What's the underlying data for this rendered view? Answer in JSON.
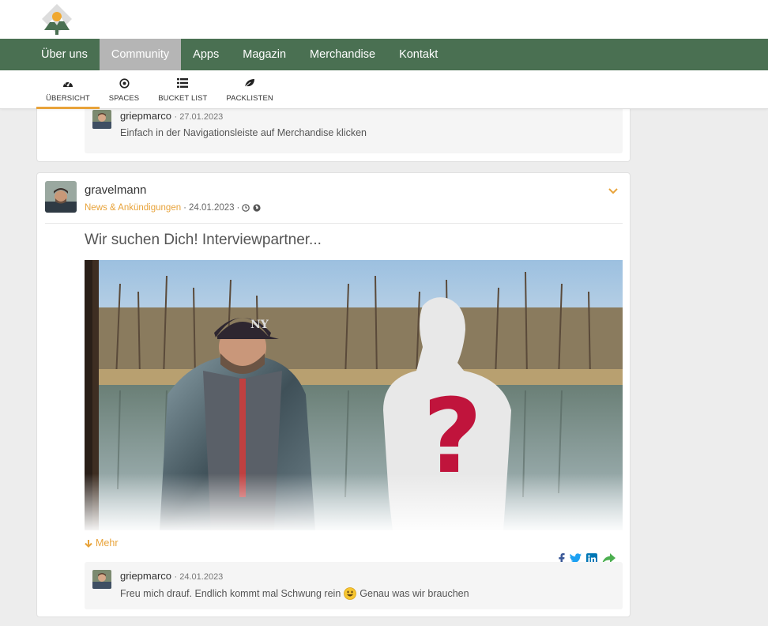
{
  "nav": {
    "items": [
      {
        "label": "Über uns",
        "active": false
      },
      {
        "label": "Community",
        "active": true
      },
      {
        "label": "Apps",
        "active": false
      },
      {
        "label": "Magazin",
        "active": false
      },
      {
        "label": "Merchandise",
        "active": false
      },
      {
        "label": "Kontakt",
        "active": false
      }
    ]
  },
  "subnav": {
    "items": [
      {
        "label": "ÜBERSICHT",
        "icon": "dashboard-icon",
        "active": true
      },
      {
        "label": "SPACES",
        "icon": "target-icon",
        "active": false
      },
      {
        "label": "BUCKET LIST",
        "icon": "list-icon",
        "active": false
      },
      {
        "label": "PACKLISTEN",
        "icon": "leaf-icon",
        "active": false
      }
    ]
  },
  "post1": {
    "comment": {
      "author": "griepmarco",
      "date": "27.01.2023",
      "text": "Einfach in der Navigationsleiste auf Merchandise klicken"
    }
  },
  "post2": {
    "author": "gravelmann",
    "space": "News & Ankündigungen",
    "date": "24.01.2023",
    "title": "Wir suchen Dich! Interviewpartner...",
    "more_label": "Mehr",
    "comment": {
      "author": "griepmarco",
      "date": "24.01.2023",
      "text_before": "Freu mich drauf. Endlich kommt mal Schwung rein",
      "text_after": "Genau was wir brauchen"
    }
  },
  "colors": {
    "nav_bg": "#4a7052",
    "accent": "#e8a33a",
    "facebook": "#3b5998",
    "twitter": "#1da1f2",
    "linkedin": "#0077b5",
    "share": "#4caf50"
  }
}
